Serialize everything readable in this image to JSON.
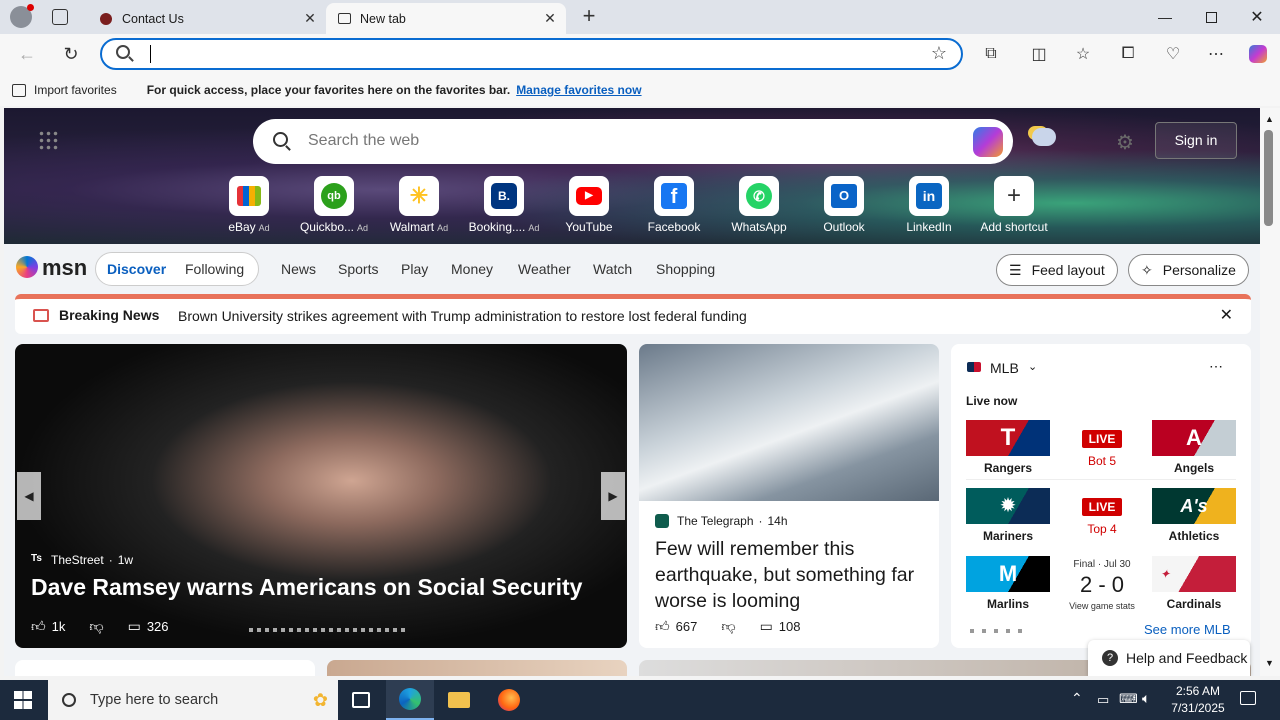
{
  "tabs": [
    {
      "label": "Contact Us",
      "active": false
    },
    {
      "label": "New tab",
      "active": true
    }
  ],
  "address": {
    "value": "",
    "placeholder": ""
  },
  "favbar": {
    "import_label": "Import favorites",
    "message": "For quick access, place your favorites here on the favorites bar.",
    "manage_link": "Manage favorites now"
  },
  "search": {
    "placeholder": "Search the web"
  },
  "signin": "Sign in",
  "shortcuts": [
    {
      "label": "eBay",
      "ad": "Ad",
      "color": "#e53238",
      "glyph": "🛍"
    },
    {
      "label": "Quickbo...",
      "ad": "Ad",
      "color": "#2ca01c",
      "glyph": "qb"
    },
    {
      "label": "Walmart",
      "ad": "Ad",
      "color": "#0071ce",
      "glyph": "✳"
    },
    {
      "label": "Booking....",
      "ad": "Ad",
      "color": "#003580",
      "glyph": "B."
    },
    {
      "label": "YouTube",
      "ad": "",
      "color": "#ff0000",
      "glyph": "▶"
    },
    {
      "label": "Facebook",
      "ad": "",
      "color": "#1877f2",
      "glyph": "f"
    },
    {
      "label": "WhatsApp",
      "ad": "",
      "color": "#25d366",
      "glyph": "✆"
    },
    {
      "label": "Outlook",
      "ad": "",
      "color": "#0a64c8",
      "glyph": "O"
    },
    {
      "label": "LinkedIn",
      "ad": "",
      "color": "#0a66c2",
      "glyph": "in"
    },
    {
      "label": "Add shortcut",
      "ad": "",
      "color": "#555555",
      "glyph": "+"
    }
  ],
  "msnnav": {
    "logo": "msn",
    "discover": "Discover",
    "following": "Following",
    "links": [
      "News",
      "Sports",
      "Play",
      "Money",
      "Weather",
      "Watch",
      "Shopping"
    ],
    "feed_layout": "Feed layout",
    "personalize": "Personalize"
  },
  "breaking": {
    "label": "Breaking News",
    "headline": "Brown University strikes agreement with Trump administration to restore lost federal funding"
  },
  "main_card": {
    "source": "TheStreet",
    "age": "1w",
    "headline": "Dave Ramsey warns Americans on Social Security",
    "likes": "1k",
    "comments": "326"
  },
  "second_card": {
    "source": "The Telegraph",
    "age": "14h",
    "headline": "Few will remember this earthquake, but something far worse is looming",
    "likes": "667",
    "comments": "108"
  },
  "mlb": {
    "title": "MLB",
    "live_now": "Live now",
    "games": [
      {
        "home": "Rangers",
        "away": "Angels",
        "status": "LIVE",
        "detail": "Bot 5",
        "home_color": "#c0111f",
        "away_color": "#ba0021"
      },
      {
        "home": "Mariners",
        "away": "Athletics",
        "status": "LIVE",
        "detail": "Top 4",
        "home_color": "#005c5c",
        "away_color": "#003831"
      },
      {
        "home": "Marlins",
        "away": "Cardinals",
        "status": "Final · Jul 30",
        "score": "2 - 0",
        "detail": "View game stats",
        "home_color": "#00a3e0",
        "away_color": "#c41e3a"
      }
    ],
    "see_more": "See more MLB"
  },
  "help_feedback": "Help and Feedback",
  "taskbar": {
    "search_placeholder": "Type here to search",
    "time": "2:56 AM",
    "date": "7/31/2025"
  }
}
